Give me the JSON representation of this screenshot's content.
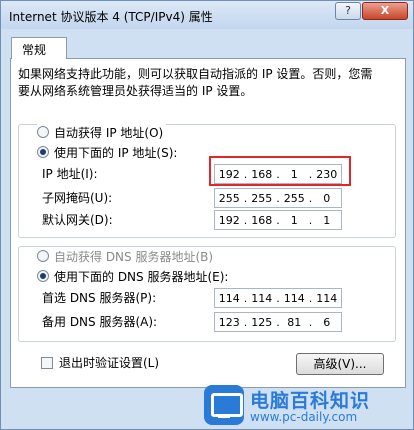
{
  "window": {
    "title": "Internet 协议版本 4 (TCP/IPv4) 属性",
    "help_label": "?",
    "close_label": "X"
  },
  "tab": {
    "label": "常规"
  },
  "description": "如果网络支持此功能，则可以获取自动指派的 IP 设置。否则，您需要从网络系统管理员处获得适当的 IP 设置。",
  "ip_section": {
    "auto_label": "自动获得 IP 地址(O)",
    "auto_checked": false,
    "manual_label": "使用下面的 IP 地址(S):",
    "manual_checked": true,
    "fields": [
      {
        "label": "IP 地址(I):",
        "octets": [
          "192",
          "168",
          "1",
          "230"
        ]
      },
      {
        "label": "子网掩码(U):",
        "octets": [
          "255",
          "255",
          "255",
          "0"
        ]
      },
      {
        "label": "默认网关(D):",
        "octets": [
          "192",
          "168",
          "1",
          "1"
        ]
      }
    ]
  },
  "dns_section": {
    "auto_label": "自动获得 DNS 服务器地址(B)",
    "auto_checked": false,
    "auto_disabled": true,
    "manual_label": "使用下面的 DNS 服务器地址(E):",
    "manual_checked": true,
    "fields": [
      {
        "label": "首选 DNS 服务器(P):",
        "octets": [
          "114",
          "114",
          "114",
          "114"
        ]
      },
      {
        "label": "备用 DNS 服务器(A):",
        "octets": [
          "123",
          "125",
          "81",
          "6"
        ]
      }
    ]
  },
  "validate_on_exit": {
    "label": "退出时验证设置(L)",
    "checked": false
  },
  "advanced_button": "高级(V)...",
  "watermark": {
    "title": "电脑百科知识",
    "url": "www.pc-daily.com",
    "accent": "#2a7bd8"
  },
  "colors": {
    "highlight": "#e0282a",
    "window_bg": "#cfe0f3"
  }
}
